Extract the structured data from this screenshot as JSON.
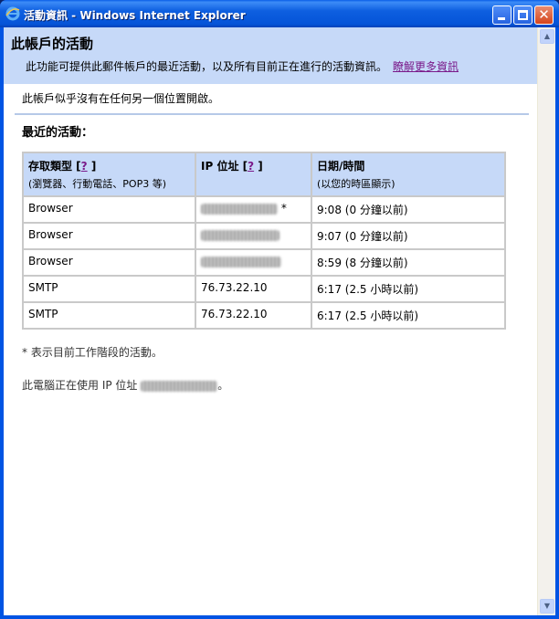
{
  "window": {
    "title": "活動資訊 - Windows Internet Explorer",
    "icon": "ie-icon"
  },
  "header": {
    "title": "此帳戶的活動",
    "description": "此功能可提供此郵件帳戶的最近活動，以及所有目前正在進行的活動資訊。",
    "learn_more": "瞭解更多資訊"
  },
  "no_other_session": "此帳戶似乎沒有在任何另一個位置開啟。",
  "recent_title": "最近的活動：",
  "table": {
    "headers": [
      {
        "label": "存取類型 [",
        "help": "?",
        "close": " ]",
        "sub": "(瀏覽器、行動電話、POP3 等)"
      },
      {
        "label": "IP 位址 [",
        "help": "?",
        "close": " ]",
        "sub": ""
      },
      {
        "label": "日期/時間",
        "help": "",
        "close": "",
        "sub": "(以您的時區顯示)"
      }
    ],
    "rows": [
      {
        "type": "Browser",
        "ip": "",
        "ip_redacted": true,
        "ip_suffix": " *",
        "time": "9:08 (0 分鐘以前)"
      },
      {
        "type": "Browser",
        "ip": "",
        "ip_redacted": true,
        "ip_suffix": "",
        "time": "9:07 (0 分鐘以前)"
      },
      {
        "type": "Browser",
        "ip": "",
        "ip_redacted": true,
        "ip_suffix": "",
        "time": "8:59 (8 分鐘以前)"
      },
      {
        "type": "SMTP",
        "ip": "76.73.22.10",
        "ip_redacted": false,
        "ip_suffix": "",
        "time": "6:17 (2.5 小時以前)"
      },
      {
        "type": "SMTP",
        "ip": "76.73.22.10",
        "ip_redacted": false,
        "ip_suffix": "",
        "time": "6:17 (2.5 小時以前)"
      }
    ]
  },
  "footnote_session": "* 表示目前工作階段的活動。",
  "footnote_ip_prefix": "此電腦正在使用 IP 位址 ",
  "footnote_ip_suffix": "。",
  "colors": {
    "header_band": "#c6d9f8",
    "link": "#7a1a8a",
    "titlebar": "#0554d8"
  }
}
